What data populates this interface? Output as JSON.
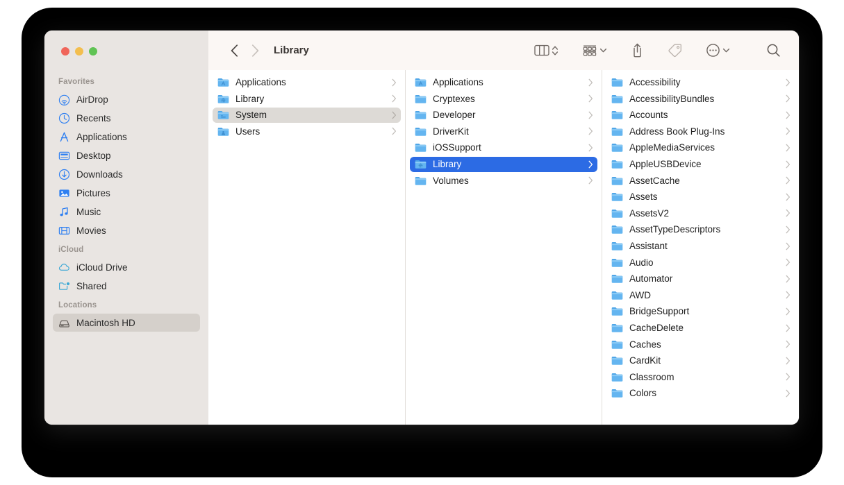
{
  "window": {
    "title": "Library",
    "traffic_lights": [
      {
        "name": "close",
        "color": "#F0655A"
      },
      {
        "name": "minimize",
        "color": "#F3BE4E"
      },
      {
        "name": "zoom",
        "color": "#60C354"
      }
    ]
  },
  "toolbar": {
    "back_icon": "chevron-left-icon",
    "forward_icon": "chevron-right-icon",
    "back_enabled": true,
    "forward_enabled": false,
    "view_icon": "column-view-icon",
    "view_stepper_icon": "up-down-chevron-icon",
    "group_icon": "group-by-icon",
    "group_chevron_icon": "chevron-down-icon",
    "share_icon": "share-icon",
    "tag_icon": "tag-icon",
    "more_icon": "ellipsis-circle-icon",
    "more_chevron_icon": "chevron-down-icon",
    "search_icon": "search-icon"
  },
  "sidebar": {
    "sections": [
      {
        "title": "Favorites",
        "items": [
          {
            "label": "AirDrop",
            "icon": "airdrop-icon",
            "selected": false
          },
          {
            "label": "Recents",
            "icon": "clock-icon",
            "selected": false
          },
          {
            "label": "Applications",
            "icon": "applications-icon",
            "selected": false
          },
          {
            "label": "Desktop",
            "icon": "desktop-icon",
            "selected": false
          },
          {
            "label": "Downloads",
            "icon": "download-icon",
            "selected": false
          },
          {
            "label": "Pictures",
            "icon": "pictures-icon",
            "selected": false
          },
          {
            "label": "Music",
            "icon": "music-note-icon",
            "selected": false
          },
          {
            "label": "Movies",
            "icon": "film-icon",
            "selected": false
          }
        ]
      },
      {
        "title": "iCloud",
        "items": [
          {
            "label": "iCloud Drive",
            "icon": "cloud-icon",
            "selected": false
          },
          {
            "label": "Shared",
            "icon": "shared-folder-icon",
            "selected": false
          }
        ]
      },
      {
        "title": "Locations",
        "items": [
          {
            "label": "Macintosh HD",
            "icon": "hard-drive-icon",
            "selected": true
          }
        ]
      }
    ]
  },
  "columns": [
    {
      "name": "column-one",
      "items": [
        {
          "label": "Applications",
          "icon": "folder-applications-icon",
          "selected": false
        },
        {
          "label": "Library",
          "icon": "folder-library-icon",
          "selected": false
        },
        {
          "label": "System",
          "icon": "folder-system-icon",
          "selected": true,
          "selection": "gray"
        },
        {
          "label": "Users",
          "icon": "folder-users-icon",
          "selected": false
        }
      ]
    },
    {
      "name": "column-two",
      "items": [
        {
          "label": "Applications",
          "icon": "folder-applications-icon",
          "selected": false
        },
        {
          "label": "Cryptexes",
          "icon": "folder-icon",
          "selected": false
        },
        {
          "label": "Developer",
          "icon": "folder-icon",
          "selected": false
        },
        {
          "label": "DriverKit",
          "icon": "folder-icon",
          "selected": false
        },
        {
          "label": "iOSSupport",
          "icon": "folder-icon",
          "selected": false
        },
        {
          "label": "Library",
          "icon": "folder-library-icon",
          "selected": true,
          "selection": "blue"
        },
        {
          "label": "Volumes",
          "icon": "folder-icon",
          "selected": false
        }
      ]
    },
    {
      "name": "column-three",
      "items": [
        {
          "label": "Accessibility",
          "icon": "folder-icon",
          "selected": false
        },
        {
          "label": "AccessibilityBundles",
          "icon": "folder-icon",
          "selected": false
        },
        {
          "label": "Accounts",
          "icon": "folder-icon",
          "selected": false
        },
        {
          "label": "Address Book Plug-Ins",
          "icon": "folder-icon",
          "selected": false
        },
        {
          "label": "AppleMediaServices",
          "icon": "folder-icon",
          "selected": false
        },
        {
          "label": "AppleUSBDevice",
          "icon": "folder-icon",
          "selected": false
        },
        {
          "label": "AssetCache",
          "icon": "folder-icon",
          "selected": false
        },
        {
          "label": "Assets",
          "icon": "folder-icon",
          "selected": false
        },
        {
          "label": "AssetsV2",
          "icon": "folder-icon",
          "selected": false
        },
        {
          "label": "AssetTypeDescriptors",
          "icon": "folder-icon",
          "selected": false
        },
        {
          "label": "Assistant",
          "icon": "folder-icon",
          "selected": false
        },
        {
          "label": "Audio",
          "icon": "folder-icon",
          "selected": false
        },
        {
          "label": "Automator",
          "icon": "folder-icon",
          "selected": false
        },
        {
          "label": "AWD",
          "icon": "folder-icon",
          "selected": false
        },
        {
          "label": "BridgeSupport",
          "icon": "folder-icon",
          "selected": false
        },
        {
          "label": "CacheDelete",
          "icon": "folder-icon",
          "selected": false
        },
        {
          "label": "Caches",
          "icon": "folder-icon",
          "selected": false
        },
        {
          "label": "CardKit",
          "icon": "folder-icon",
          "selected": false
        },
        {
          "label": "Classroom",
          "icon": "folder-icon",
          "selected": false
        },
        {
          "label": "Colors",
          "icon": "folder-icon",
          "selected": false
        }
      ]
    }
  ],
  "colors": {
    "accent_blue": "#2C6BE4",
    "sidebar_bg": "#E9E5E2",
    "toolbar_bg": "#FBF7F4",
    "selection_gray": "#D5D0CB",
    "folder_blue": "#6DB8EE",
    "sidebar_icon_blue": "#2E7FF1",
    "icloud_icon_teal": "#3FA9D6",
    "backdrop": "#000000"
  }
}
